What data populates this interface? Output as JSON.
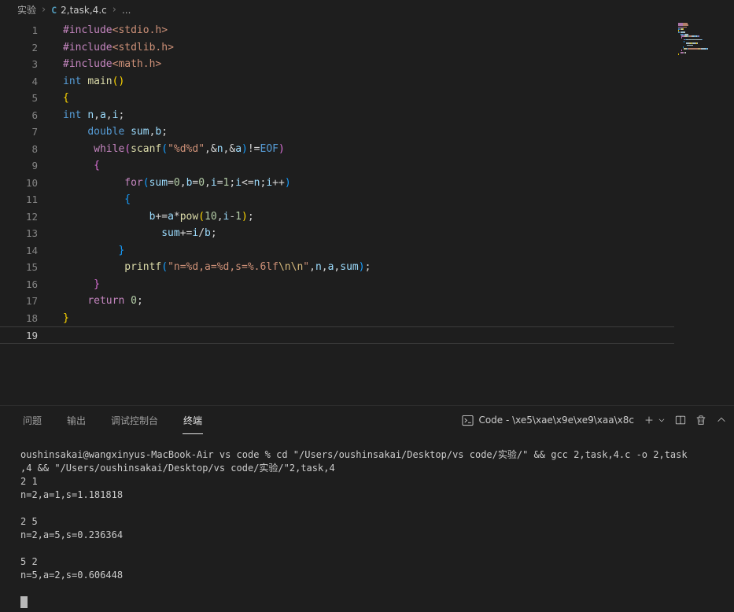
{
  "colors": {
    "editor_bg": "#1e1e1e",
    "breadcrumb_fg": "#a9a9a9",
    "breadcrumb_file_fg": "#cccccc",
    "line_number": "#858585",
    "active_line_number": "#c6c6c6",
    "active_line_border": "#3c3c3c",
    "tab_inactive": "#9d9d9d",
    "tab_active": "#e7e7e7",
    "terminal_fg": "#cccccc",
    "icon_fg": "#c5c5c5",
    "cursor": "#b9b9b9",
    "c_icon_blue": "#519aba",
    "kw": "#C586C0",
    "ty": "#569CD6",
    "fn": "#DCDCAA",
    "va": "#9CDCFE",
    "nu": "#B5CEA8",
    "st": "#CE9178",
    "es": "#D7BA7D",
    "pl": "#D4D4D4",
    "b1": "#FFD700",
    "b2": "#DA70D6",
    "b3": "#179FFF"
  },
  "breadcrumb": {
    "separator": "›",
    "c_icon": "C",
    "items": [
      {
        "label": "实验"
      },
      {
        "label": "2,task,4.c"
      },
      {
        "label": "..."
      }
    ]
  },
  "editor": {
    "active_line": 19,
    "lines": [
      {
        "n": 1,
        "indent": 0,
        "tokens": [
          [
            "kw",
            "#include"
          ],
          [
            "st",
            "<stdio.h>"
          ]
        ]
      },
      {
        "n": 2,
        "indent": 0,
        "tokens": [
          [
            "kw",
            "#include"
          ],
          [
            "st",
            "<stdlib.h>"
          ]
        ]
      },
      {
        "n": 3,
        "indent": 0,
        "tokens": [
          [
            "kw",
            "#include"
          ],
          [
            "st",
            "<math.h>"
          ]
        ]
      },
      {
        "n": 4,
        "indent": 0,
        "tokens": [
          [
            "ty",
            "int"
          ],
          [
            "pl",
            " "
          ],
          [
            "fn",
            "main"
          ],
          [
            "b1",
            "()"
          ]
        ]
      },
      {
        "n": 5,
        "indent": 0,
        "tokens": [
          [
            "b1",
            "{"
          ]
        ]
      },
      {
        "n": 6,
        "indent": 0,
        "tokens": [
          [
            "ty",
            "int"
          ],
          [
            "pl",
            " "
          ],
          [
            "va",
            "n"
          ],
          [
            "pl",
            ","
          ],
          [
            "va",
            "a"
          ],
          [
            "pl",
            ","
          ],
          [
            "va",
            "i"
          ],
          [
            "pl",
            ";"
          ]
        ]
      },
      {
        "n": 7,
        "indent": 4,
        "tokens": [
          [
            "ty",
            "double"
          ],
          [
            "pl",
            " "
          ],
          [
            "va",
            "sum"
          ],
          [
            "pl",
            ","
          ],
          [
            "va",
            "b"
          ],
          [
            "pl",
            ";"
          ]
        ]
      },
      {
        "n": 8,
        "indent": 5,
        "tokens": [
          [
            "kw",
            "while"
          ],
          [
            "b2",
            "("
          ],
          [
            "fn",
            "scanf"
          ],
          [
            "b3",
            "("
          ],
          [
            "st",
            "\"%d%d\""
          ],
          [
            "pl",
            ",&"
          ],
          [
            "va",
            "n"
          ],
          [
            "pl",
            ",&"
          ],
          [
            "va",
            "a"
          ],
          [
            "b3",
            ")"
          ],
          [
            "pl",
            "!="
          ],
          [
            "ty",
            "EOF"
          ],
          [
            "b2",
            ")"
          ]
        ]
      },
      {
        "n": 9,
        "indent": 5,
        "tokens": [
          [
            "b2",
            "{"
          ]
        ]
      },
      {
        "n": 10,
        "indent": 10,
        "tokens": [
          [
            "kw",
            "for"
          ],
          [
            "b3",
            "("
          ],
          [
            "va",
            "sum"
          ],
          [
            "pl",
            "="
          ],
          [
            "nu",
            "0"
          ],
          [
            "pl",
            ","
          ],
          [
            "va",
            "b"
          ],
          [
            "pl",
            "="
          ],
          [
            "nu",
            "0"
          ],
          [
            "pl",
            ","
          ],
          [
            "va",
            "i"
          ],
          [
            "pl",
            "="
          ],
          [
            "nu",
            "1"
          ],
          [
            "pl",
            ";"
          ],
          [
            "va",
            "i"
          ],
          [
            "pl",
            "<="
          ],
          [
            "va",
            "n"
          ],
          [
            "pl",
            ";"
          ],
          [
            "va",
            "i"
          ],
          [
            "pl",
            "++"
          ],
          [
            "b3",
            ")"
          ]
        ]
      },
      {
        "n": 11,
        "indent": 10,
        "tokens": [
          [
            "b3",
            "{"
          ]
        ]
      },
      {
        "n": 12,
        "indent": 14,
        "tokens": [
          [
            "va",
            "b"
          ],
          [
            "pl",
            "+="
          ],
          [
            "va",
            "a"
          ],
          [
            "pl",
            "*"
          ],
          [
            "fn",
            "pow"
          ],
          [
            "b1",
            "("
          ],
          [
            "nu",
            "10"
          ],
          [
            "pl",
            ","
          ],
          [
            "va",
            "i"
          ],
          [
            "pl",
            "-"
          ],
          [
            "nu",
            "1"
          ],
          [
            "b1",
            ")"
          ],
          [
            "pl",
            ";"
          ]
        ]
      },
      {
        "n": 13,
        "indent": 16,
        "tokens": [
          [
            "va",
            "sum"
          ],
          [
            "pl",
            "+="
          ],
          [
            "va",
            "i"
          ],
          [
            "pl",
            "/"
          ],
          [
            "va",
            "b"
          ],
          [
            "pl",
            ";"
          ]
        ]
      },
      {
        "n": 14,
        "indent": 9,
        "tokens": [
          [
            "b3",
            "}"
          ]
        ]
      },
      {
        "n": 15,
        "indent": 10,
        "tokens": [
          [
            "fn",
            "printf"
          ],
          [
            "b3",
            "("
          ],
          [
            "st",
            "\"n=%d,a=%d,s=%.6lf"
          ],
          [
            "es",
            "\\n\\n"
          ],
          [
            "st",
            "\""
          ],
          [
            "pl",
            ","
          ],
          [
            "va",
            "n"
          ],
          [
            "pl",
            ","
          ],
          [
            "va",
            "a"
          ],
          [
            "pl",
            ","
          ],
          [
            "va",
            "sum"
          ],
          [
            "b3",
            ")"
          ],
          [
            "pl",
            ";"
          ]
        ]
      },
      {
        "n": 16,
        "indent": 5,
        "tokens": [
          [
            "b2",
            "}"
          ]
        ]
      },
      {
        "n": 17,
        "indent": 4,
        "tokens": [
          [
            "kw",
            "return"
          ],
          [
            "pl",
            " "
          ],
          [
            "nu",
            "0"
          ],
          [
            "pl",
            ";"
          ]
        ]
      },
      {
        "n": 18,
        "indent": 0,
        "tokens": [
          [
            "b1",
            "}"
          ]
        ]
      },
      {
        "n": 19,
        "indent": 0,
        "tokens": []
      }
    ]
  },
  "panel": {
    "tabs": [
      {
        "id": "problems",
        "label": "问题",
        "active": false
      },
      {
        "id": "output",
        "label": "输出",
        "active": false
      },
      {
        "id": "debug-console",
        "label": "调试控制台",
        "active": false
      },
      {
        "id": "terminal",
        "label": "终端",
        "active": true
      }
    ],
    "toolbar": {
      "terminal_label": "Code - \\xe5\\xae\\x9e\\xe9\\xaa\\x8c"
    }
  },
  "terminal": {
    "lines": [
      "oushinsakai@wangxinyus-MacBook-Air vs code % cd \"/Users/oushinsakai/Desktop/vs code/实验/\" && gcc 2,task,4.c -o 2,task",
      ",4 && \"/Users/oushinsakai/Desktop/vs code/实验/\"2,task,4",
      "2 1",
      "n=2,a=1,s=1.181818",
      "",
      "2 5",
      "n=2,a=5,s=0.236364",
      "",
      "5 2",
      "n=5,a=2,s=0.606448",
      ""
    ],
    "cursor": true
  }
}
